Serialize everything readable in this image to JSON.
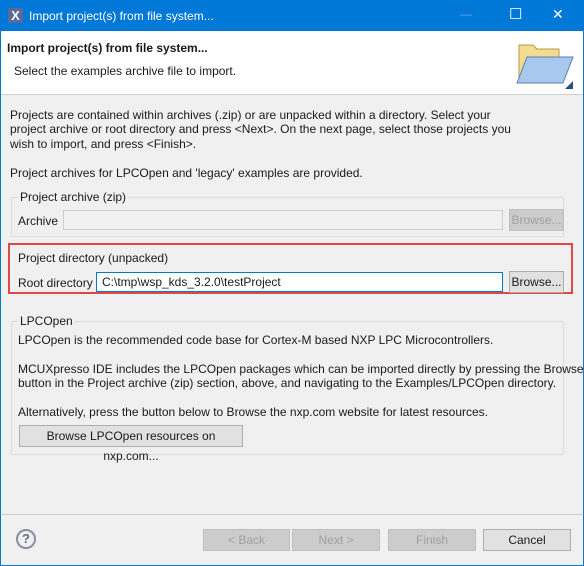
{
  "window": {
    "title": "Import project(s) from file system...",
    "app_icon": "x-app-icon",
    "minimize": "—",
    "maximize": "☐",
    "close": "✕"
  },
  "header": {
    "title": "Import project(s) from file system...",
    "subtitle": "Select the examples archive file to import.",
    "icon": "folder-open-icon"
  },
  "intro": {
    "line1": "Projects are contained within archives (.zip) or are unpacked within a directory. Select your",
    "line2": "project archive or root directory and press <Next>. On the next page, select those projects you",
    "line3": "wish to import, and press <Finish>.",
    "line4": "Project archives for LPCOpen and 'legacy' examples are provided."
  },
  "archive_group": {
    "title": "Project archive (zip)",
    "label": "Archive",
    "value": "",
    "browse": "Browse..."
  },
  "directory_group": {
    "title": "Project directory (unpacked)",
    "label": "Root directory",
    "value": "C:\\tmp\\wsp_kds_3.2.0\\testProject",
    "browse": "Browse...",
    "highlight_color": "#e04848"
  },
  "lpcopen_group": {
    "title": "LPCOpen",
    "line1": "LPCOpen is the recommended code base for Cortex-M based NXP LPC Microcontrollers.",
    "line2": "MCUXpresso IDE includes the LPCOpen packages which can be imported directly by pressing the Browse",
    "line3": "button in the Project archive (zip) section, above, and navigating to the Examples/LPCOpen directory.",
    "line4": "Alternatively, press the button below to Browse the nxp.com website for latest resources.",
    "button": "Browse LPCOpen resources on nxp.com..."
  },
  "footer": {
    "help": "?",
    "back": "< Back",
    "next": "Next >",
    "finish": "Finish",
    "cancel": "Cancel"
  }
}
